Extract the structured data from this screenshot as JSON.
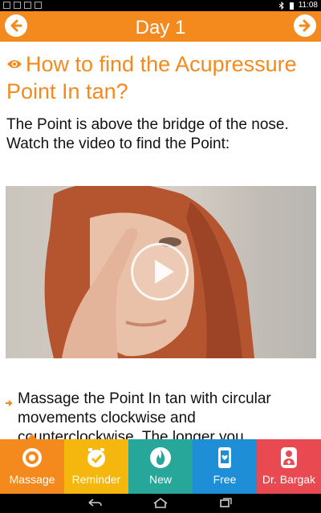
{
  "status_bar": {
    "time": "11:08"
  },
  "app_bar": {
    "title": "Day 1",
    "back_icon": "arrow-left-icon",
    "forward_icon": "arrow-right-icon"
  },
  "content": {
    "heading": "How to find the Acupressure Point In tan?",
    "intro": "The Point is above the bridge of the nose. Watch the video to find the Point:",
    "video": {
      "play_icon": "play-icon"
    },
    "bullet": "Massage the Point In tan with circular movements clockwise and counterclockwise. The longer you"
  },
  "tabs": [
    {
      "label": "Massage",
      "color": "#f48a1e",
      "icon": "target-icon",
      "active": true
    },
    {
      "label": "Reminder",
      "color": "#f5b70d",
      "icon": "alarm-icon",
      "active": false
    },
    {
      "label": "New",
      "color": "#27a69a",
      "icon": "flame-icon",
      "active": false
    },
    {
      "label": "Free",
      "color": "#1e8fd6",
      "icon": "phone-icon",
      "active": false
    },
    {
      "label": "Dr. Bargak",
      "color": "#e94a52",
      "icon": "doctor-icon",
      "active": false
    }
  ],
  "colors": {
    "accent": "#f48a1e",
    "text": "#111111"
  }
}
